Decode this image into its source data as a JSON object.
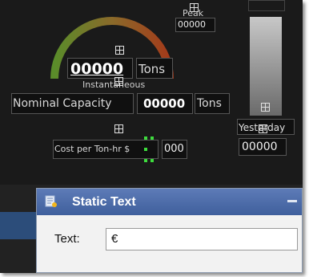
{
  "gauge": {
    "value": "00000",
    "unit": "Tons",
    "caption": "Instantaneous"
  },
  "peak": {
    "label": "Peak",
    "value": "00000"
  },
  "nominal": {
    "label": "Nominal Capacity",
    "value": "00000",
    "unit": "Tons"
  },
  "cost": {
    "label": "Cost per Ton-hr $",
    "value": "000"
  },
  "yesterday": {
    "label": "Yesterday",
    "value": "00000"
  },
  "dialog": {
    "title": "Static Text",
    "field_label": "Text:",
    "field_value": "€"
  },
  "colors": {
    "canvas": "#1a1a1a",
    "dialog_header": "#4a6aa8",
    "selection_handle": "#3ddc3d",
    "gauge_start": "#5a8c2a",
    "gauge_end": "#a43a1a"
  }
}
